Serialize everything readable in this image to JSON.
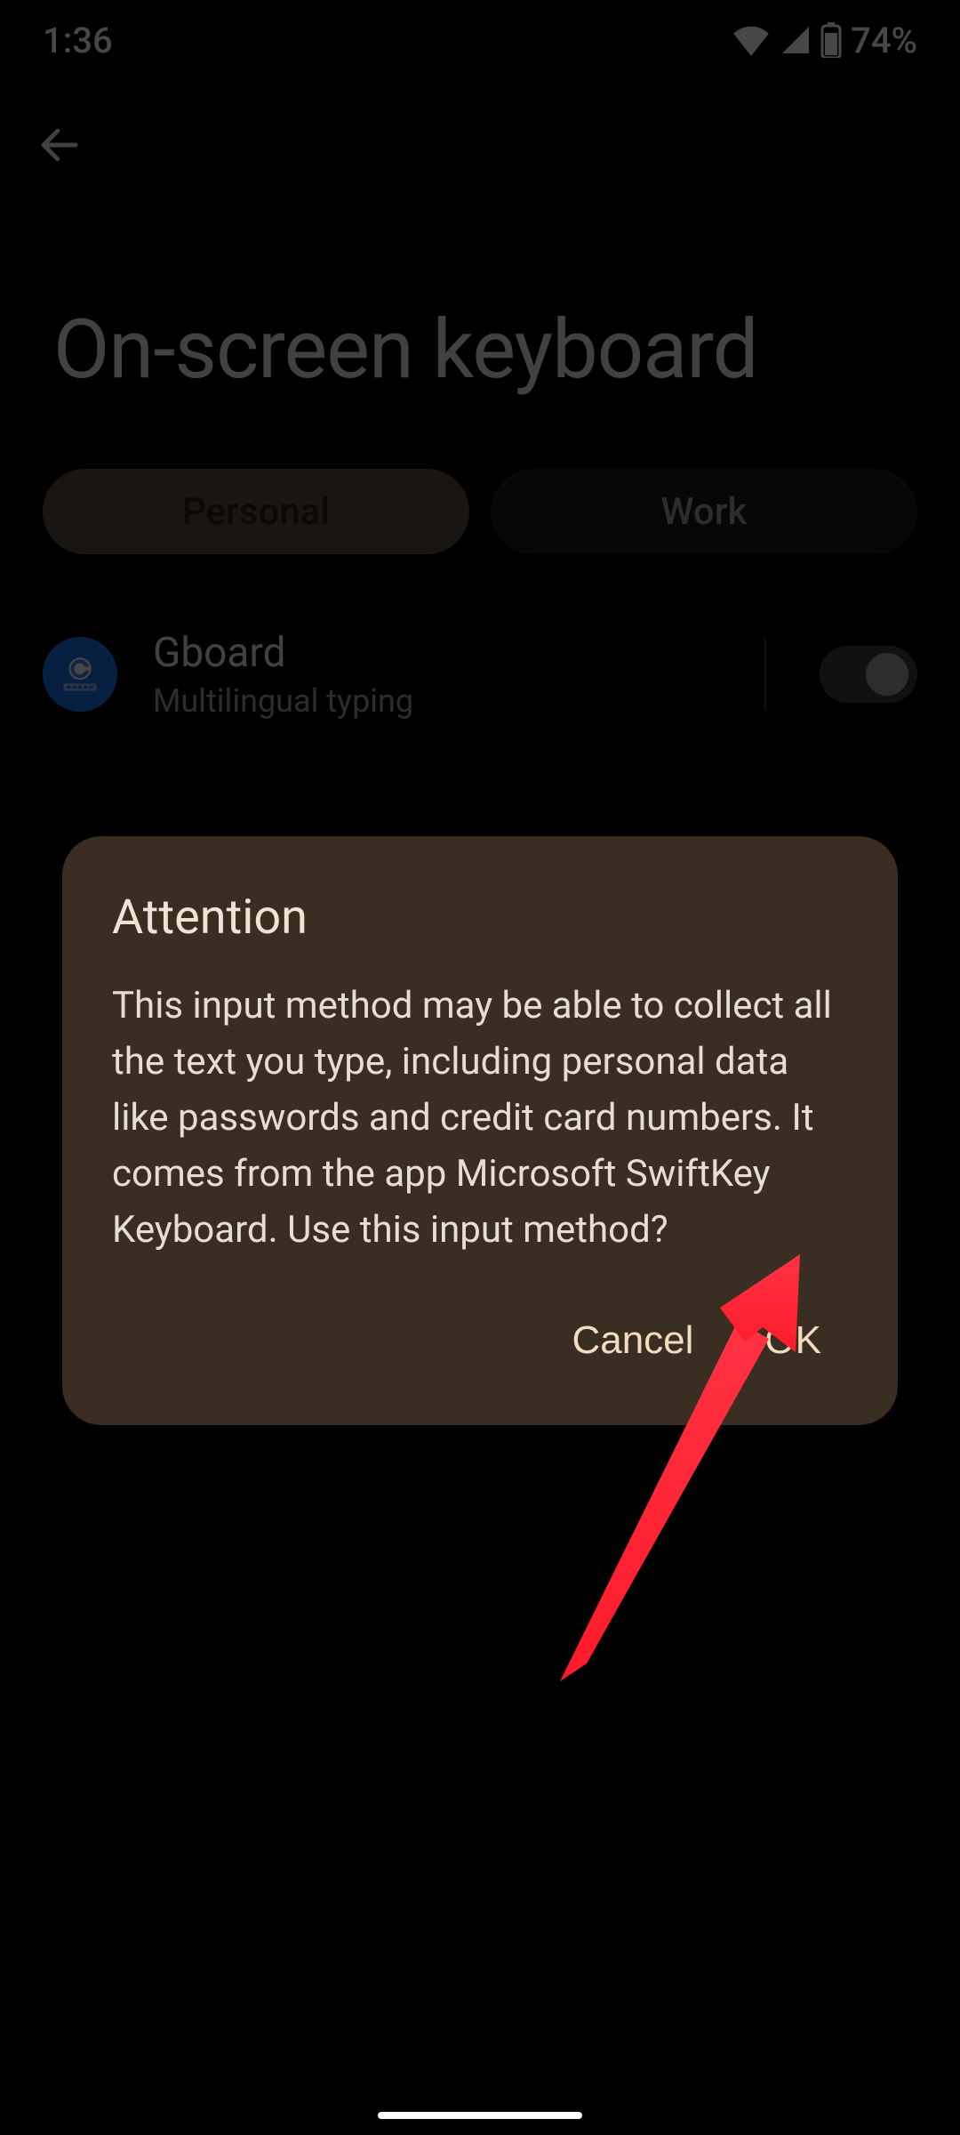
{
  "status": {
    "time": "1:36",
    "battery_pct": "74%"
  },
  "page": {
    "title": "On-screen keyboard",
    "tabs": {
      "personal": "Personal",
      "work": "Work"
    },
    "keyboards": [
      {
        "title": "Gboard",
        "subtitle": "Multilingual typing",
        "enabled": true
      }
    ]
  },
  "dialog": {
    "title": "Attention",
    "body": "This input method may be able to collect all the text you type, including personal data like passwords and credit card numbers. It comes from the app Microsoft SwiftKey Keyboard. Use this input method?",
    "cancel": "Cancel",
    "ok": "OK"
  }
}
